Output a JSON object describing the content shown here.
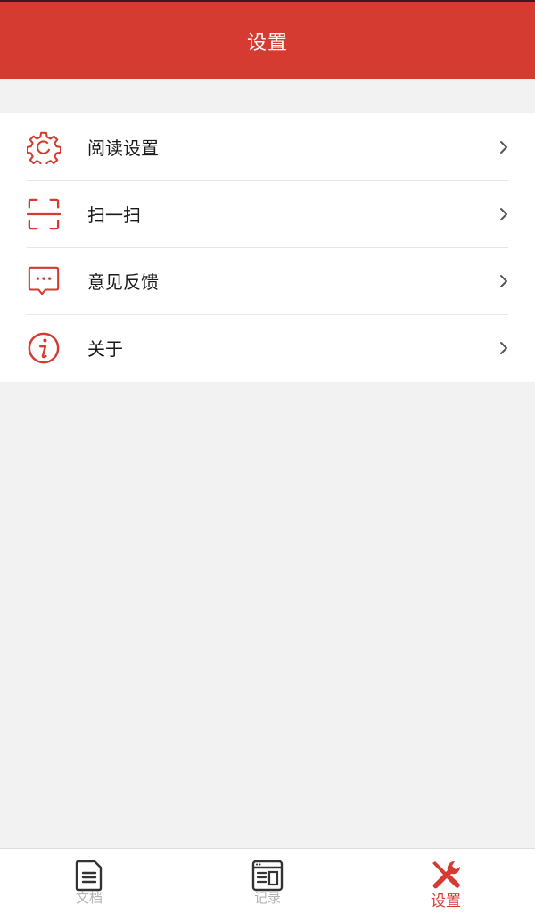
{
  "header": {
    "title": "设置"
  },
  "menu": {
    "items": [
      {
        "label": "阅读设置",
        "icon": "gear-icon"
      },
      {
        "label": "扫一扫",
        "icon": "scan-icon"
      },
      {
        "label": "意见反馈",
        "icon": "feedback-icon"
      },
      {
        "label": "关于",
        "icon": "info-icon"
      }
    ]
  },
  "tabbar": {
    "tabs": [
      {
        "label": "文档",
        "icon": "document-icon",
        "active": false
      },
      {
        "label": "记录",
        "icon": "record-icon",
        "active": false
      },
      {
        "label": "设置",
        "icon": "tools-icon",
        "active": true
      }
    ]
  },
  "colors": {
    "accent": "#d63b31",
    "inactive": "#b5b5b5",
    "background": "#f2f2f2"
  }
}
